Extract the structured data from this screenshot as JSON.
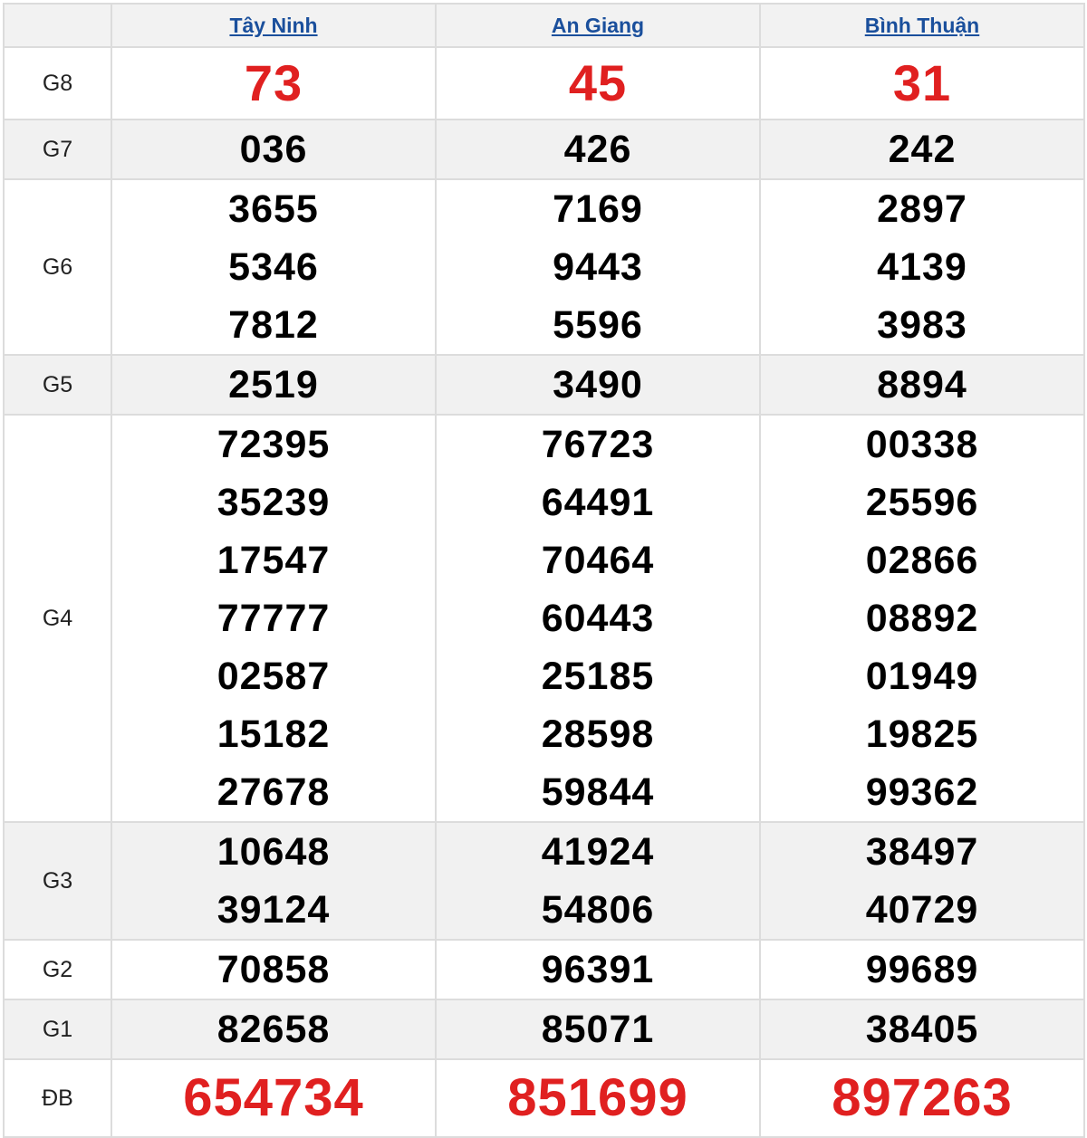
{
  "provinces": [
    "Tây Ninh",
    "An Giang",
    "Bình Thuận"
  ],
  "prizes": {
    "G8": {
      "label": "G8",
      "values": [
        [
          "73"
        ],
        [
          "45"
        ],
        [
          "31"
        ]
      ]
    },
    "G7": {
      "label": "G7",
      "values": [
        [
          "036"
        ],
        [
          "426"
        ],
        [
          "242"
        ]
      ]
    },
    "G6": {
      "label": "G6",
      "values": [
        [
          "3655",
          "5346",
          "7812"
        ],
        [
          "7169",
          "9443",
          "5596"
        ],
        [
          "2897",
          "4139",
          "3983"
        ]
      ]
    },
    "G5": {
      "label": "G5",
      "values": [
        [
          "2519"
        ],
        [
          "3490"
        ],
        [
          "8894"
        ]
      ]
    },
    "G4": {
      "label": "G4",
      "values": [
        [
          "72395",
          "35239",
          "17547",
          "77777",
          "02587",
          "15182",
          "27678"
        ],
        [
          "76723",
          "64491",
          "70464",
          "60443",
          "25185",
          "28598",
          "59844"
        ],
        [
          "00338",
          "25596",
          "02866",
          "08892",
          "01949",
          "19825",
          "99362"
        ]
      ]
    },
    "G3": {
      "label": "G3",
      "values": [
        [
          "10648",
          "39124"
        ],
        [
          "41924",
          "54806"
        ],
        [
          "38497",
          "40729"
        ]
      ]
    },
    "G2": {
      "label": "G2",
      "values": [
        [
          "70858"
        ],
        [
          "96391"
        ],
        [
          "99689"
        ]
      ]
    },
    "G1": {
      "label": "G1",
      "values": [
        [
          "82658"
        ],
        [
          "85071"
        ],
        [
          "38405"
        ]
      ]
    },
    "DB": {
      "label": "ĐB",
      "values": [
        [
          "654734"
        ],
        [
          "851699"
        ],
        [
          "897263"
        ]
      ]
    }
  },
  "colors": {
    "link": "#1a4f9c",
    "highlight_red": "#e02020",
    "shade": "#f1f1f1",
    "border": "#dcdcdc"
  }
}
